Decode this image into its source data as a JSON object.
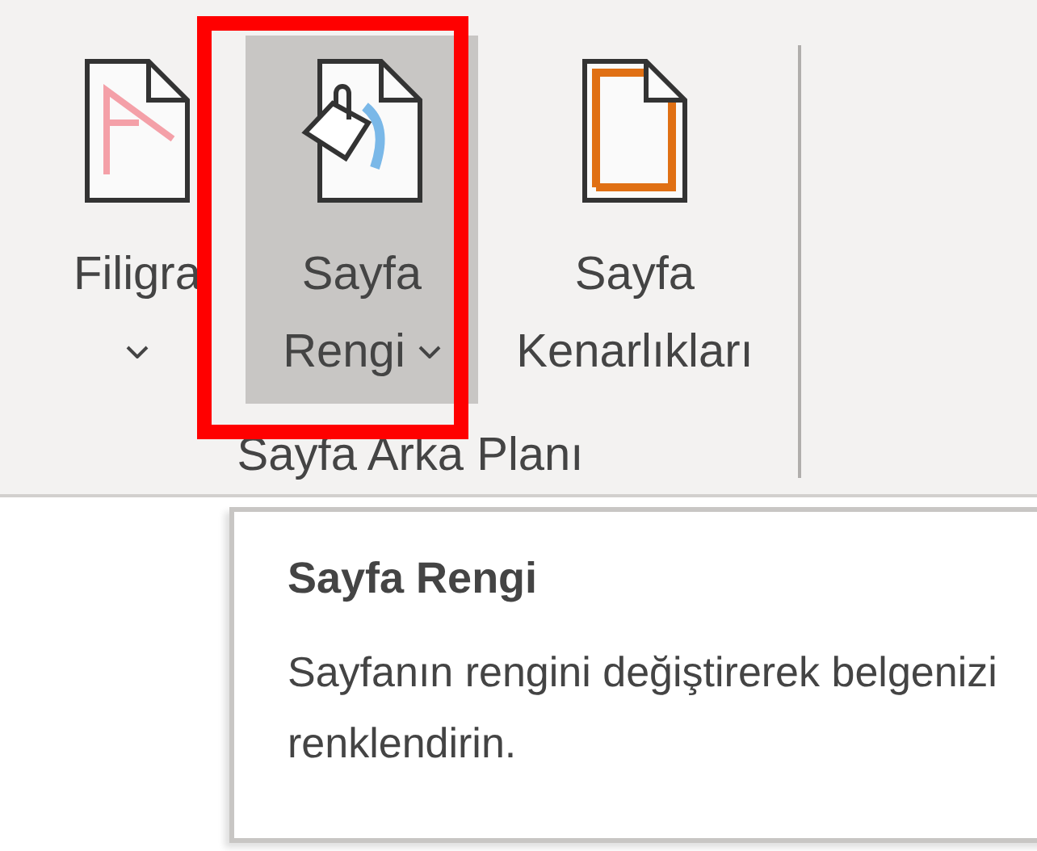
{
  "ribbon": {
    "buttons": [
      {
        "kind": "watermark",
        "lines": [
          "Filigra"
        ],
        "caret": true,
        "selected": false
      },
      {
        "kind": "page-color",
        "lines": [
          "Sayfa",
          "Rengi"
        ],
        "caret": true,
        "selected": true
      },
      {
        "kind": "page-borders",
        "lines": [
          "Sayfa",
          "Kenarlıkları"
        ],
        "caret": false,
        "selected": false
      }
    ],
    "group_label": "Sayfa Arka Planı"
  },
  "tooltip": {
    "title": "Sayfa Rengi",
    "description": "Sayfanın rengini değiştirerek belgenizi renklendirin."
  }
}
